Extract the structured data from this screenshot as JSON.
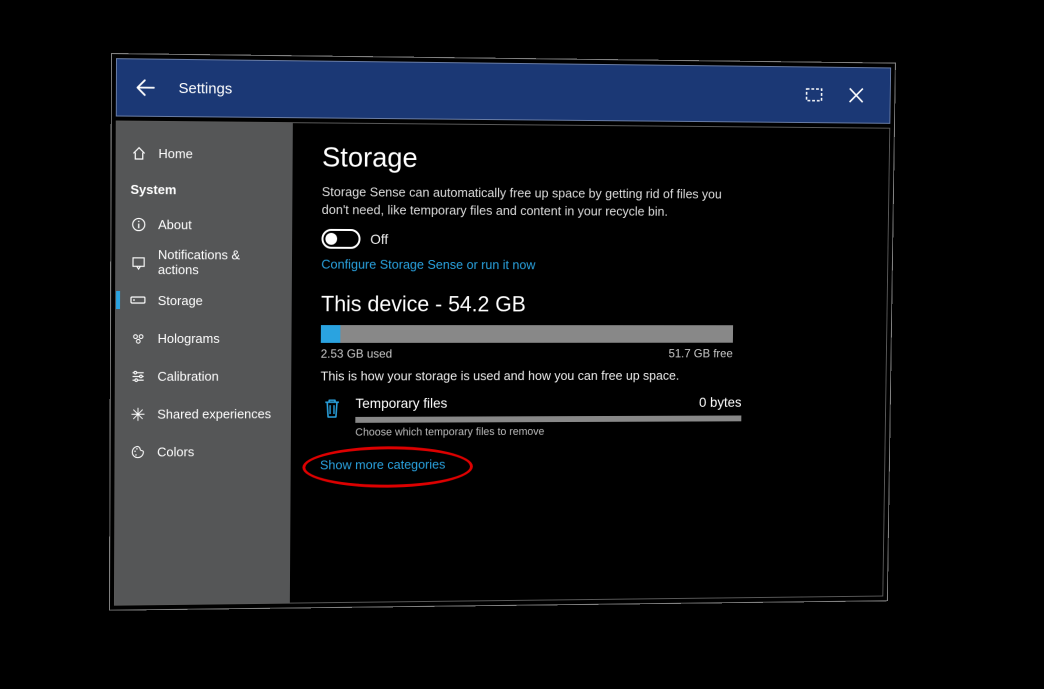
{
  "titlebar": {
    "title": "Settings"
  },
  "sidebar": {
    "home": "Home",
    "section": "System",
    "items": [
      {
        "label": "About"
      },
      {
        "label": "Notifications & actions"
      },
      {
        "label": "Storage"
      },
      {
        "label": "Holograms"
      },
      {
        "label": "Calibration"
      },
      {
        "label": "Shared experiences"
      },
      {
        "label": "Colors"
      }
    ]
  },
  "content": {
    "heading": "Storage",
    "description": "Storage Sense can automatically free up space by getting rid of files you don't need, like temporary files and content in your recycle bin.",
    "toggle_state": "Off",
    "configure_link": "Configure Storage Sense or run it now",
    "device_heading": "This device - 54.2 GB",
    "usage": {
      "used_label": "2.53 GB used",
      "free_label": "51.7 GB free",
      "used_pct": 4.7
    },
    "usage_hint": "This is how your storage is used and how you can free up space.",
    "categories": [
      {
        "name": "Temporary files",
        "size": "0 bytes",
        "sub": "Choose which temporary files to remove"
      }
    ],
    "show_more": "Show more categories"
  },
  "colors": {
    "accent": "#2aa3e0",
    "titlebar": "#1b3875"
  }
}
